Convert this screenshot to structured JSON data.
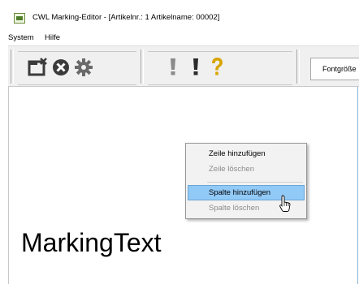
{
  "window": {
    "title": "CWL Marking-Editor - [Artikelnr.: 1   Artikelname: 00002]"
  },
  "menubar": {
    "items": [
      "System",
      "Hilfe"
    ]
  },
  "toolbar": {
    "buttons": [
      {
        "icon": "window-close-icon"
      },
      {
        "icon": "cancel-circle-icon"
      },
      {
        "icon": "gear-icon"
      },
      {
        "icon": "exclamation-gray-icon"
      },
      {
        "icon": "exclamation-black-icon"
      },
      {
        "icon": "question-mark-icon"
      }
    ],
    "fontsize_label": "Fontgröße"
  },
  "canvas": {
    "marking_text": "MarkingText"
  },
  "context_menu": {
    "items": [
      {
        "label": "Zeile hinzufügen",
        "enabled": true
      },
      {
        "label": "Zeile löschen",
        "enabled": false
      },
      {
        "label": "Spalte hinzufügen",
        "enabled": true,
        "highlighted": true
      },
      {
        "label": "Spalte löschen",
        "enabled": false
      }
    ]
  },
  "colors": {
    "highlight": "#91c9f7",
    "question_mark": "#d8a400",
    "disabled_text": "#8c8c8c"
  }
}
